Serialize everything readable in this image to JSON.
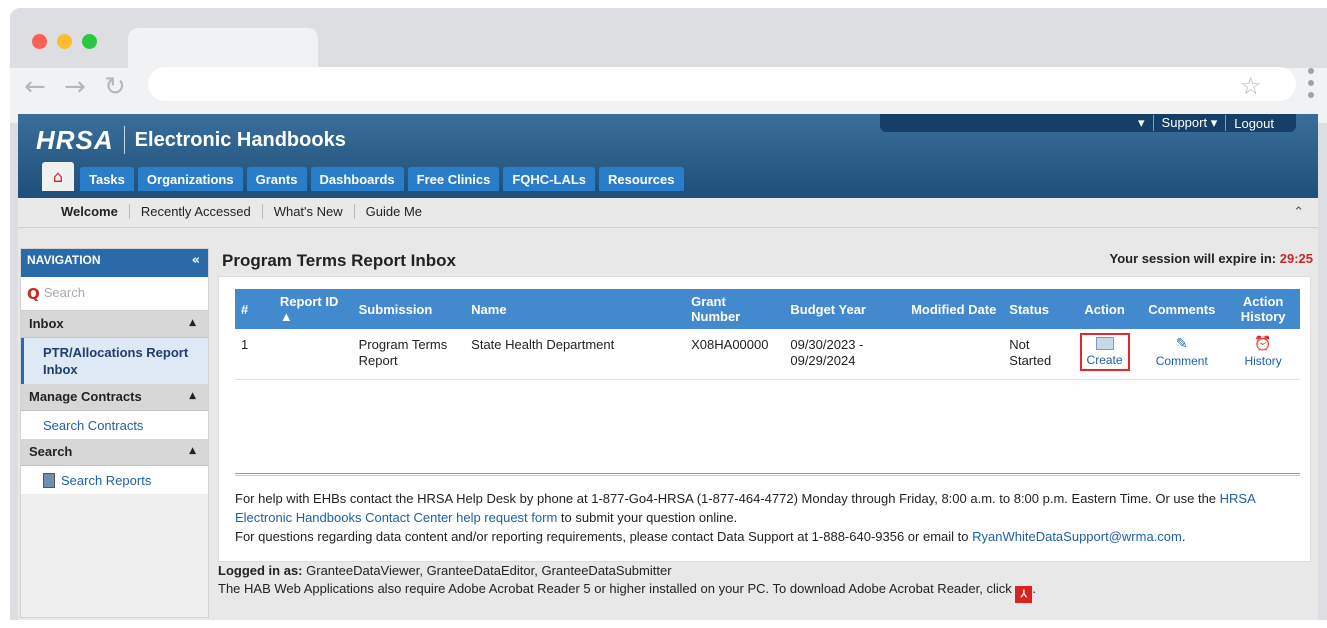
{
  "browser": {
    "traffic_lights": [
      "#ff5f57",
      "#febc2e",
      "#28c840"
    ],
    "back_icon": "back-arrow-icon",
    "forward_icon": "forward-arrow-icon",
    "reload_icon": "reload-icon",
    "star_icon": "bookmark-star-icon"
  },
  "header": {
    "logo_text": "HRSA",
    "app_title": "Electronic Handbooks",
    "support_label": "Support",
    "logout_label": "Logout"
  },
  "main_nav": {
    "home_icon": "home-icon",
    "tabs": [
      "Tasks",
      "Organizations",
      "Grants",
      "Dashboards",
      "Free Clinics",
      "FQHC-LALs",
      "Resources"
    ]
  },
  "sub_nav": {
    "items": [
      "Welcome",
      "Recently Accessed",
      "What's New",
      "Guide Me"
    ],
    "active": "Welcome"
  },
  "sidebar": {
    "title": "NAVIGATION",
    "search_placeholder": "Search",
    "sections": [
      {
        "label": "Inbox",
        "items": [
          "PTR/Allocations Report Inbox"
        ]
      },
      {
        "label": "Manage Contracts",
        "items": [
          "Search Contracts"
        ]
      },
      {
        "label": "Search",
        "items": [
          "Search Reports"
        ]
      }
    ]
  },
  "main": {
    "page_title": "Program Terms Report Inbox",
    "session_label": "Your session will expire in:",
    "session_time": "29:25",
    "table": {
      "columns": [
        "#",
        "Report ID",
        "Submission",
        "Name",
        "Grant Number",
        "Budget Year",
        "Modified Date",
        "Status",
        "Action",
        "Comments",
        "Action History"
      ],
      "rows": [
        {
          "num": "1",
          "report_id": "",
          "submission": "Program Terms Report",
          "name": "State Health Department",
          "grant_number": "X08HA00000",
          "budget_year": "09/30/2023 - 09/29/2024",
          "modified_date": "",
          "status": "Not Started",
          "action": "Create",
          "comments": "Comment",
          "history": "History"
        }
      ]
    },
    "help": {
      "line1_a": "For help with EHBs contact the HRSA Help Desk by phone at 1-877-Go4-HRSA (1-877-464-4772) Monday through Friday, 8:00 a.m. to 8:00 p.m. Eastern Time. Or use the",
      "link1": "HRSA Electronic Handbooks Contact Center help request form",
      "line1_b": "to submit your question online.",
      "line2_a": "For questions regarding data content and/or reporting requirements, please contact Data Support at 1-888-640-9356 or email to",
      "email": "RyanWhiteDataSupport@wrma.com",
      "line2_b": "."
    }
  },
  "footer": {
    "logged_in_label": "Logged in as:",
    "logged_in_value": "GranteeDataViewer, GranteeDataEditor, GranteeDataSubmitter",
    "acrobat_text": "The HAB Web Applications also require Adobe Acrobat Reader 5 or higher installed on your PC. To download Adobe Acrobat Reader, click",
    "acrobat_end": "."
  }
}
